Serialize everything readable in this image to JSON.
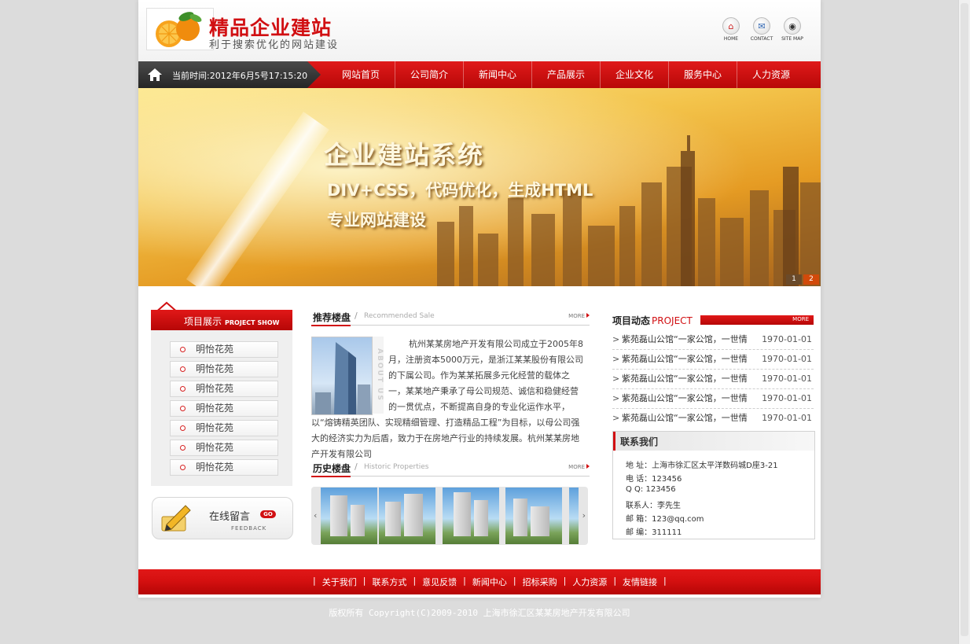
{
  "header": {
    "site_title": "精品企业建站",
    "site_subtitle": "利于搜索优化的网站建设",
    "top_icons": [
      {
        "name": "home-icon",
        "label": "HOME"
      },
      {
        "name": "contact-icon",
        "label": "CONTACT"
      },
      {
        "name": "sitemap-icon",
        "label": "SITE MAP"
      }
    ]
  },
  "nav": {
    "time_text": "当前时间:2012年6月5号17:15:20",
    "links": [
      "网站首页",
      "公司简介",
      "新闻中心",
      "产品展示",
      "企业文化",
      "服务中心",
      "人力资源"
    ]
  },
  "banner": {
    "line1": "企业建站系统",
    "line2": "DIV+CSS，代码优化，生成HTML",
    "line3": "专业网站建设",
    "pager": [
      "1",
      "2"
    ]
  },
  "left": {
    "title": "项目展示",
    "title_en": "PROJECT SHOW",
    "items": [
      "明怡花苑",
      "明怡花苑",
      "明怡花苑",
      "明怡花苑",
      "明怡花苑",
      "明怡花苑",
      "明怡花苑"
    ],
    "feedback_label": "在线留言",
    "feedback_go": "GO",
    "feedback_en": "FEEDBACK"
  },
  "middle": {
    "recommend_title": "推荐楼盘",
    "recommend_en": "Recommended Sale",
    "more": "MORE",
    "about_side": "ABOUT US",
    "about_text": "杭州某某房地产开发有限公司成立于2005年8月，注册资本5000万元，是浙江某某股份有限公司的下属公司。作为某某拓展多元化经营的载体之一，某某地产秉承了母公司规范、诚信和稳健经营的一贯优点，不断提高自身的专业化运作水平，以“熔铸精英团队、实现精细管理、打造精品工程”为目标，以母公司强大的经济实力为后盾，致力于在房地产行业的持续发展。杭州某某房地产开发有限公司",
    "history_title": "历史楼盘",
    "history_en": "Historic Properties",
    "gallery_prev": "‹",
    "gallery_next": "›"
  },
  "right": {
    "title": "项目动态",
    "title_en": "PROJECT",
    "more": "MORE",
    "news": [
      {
        "title": "紫苑磊山公馆“一家公馆，一世情",
        "date": "1970-01-01"
      },
      {
        "title": "紫苑磊山公馆“一家公馆，一世情",
        "date": "1970-01-01"
      },
      {
        "title": "紫苑磊山公馆“一家公馆，一世情",
        "date": "1970-01-01"
      },
      {
        "title": "紫苑磊山公馆“一家公馆，一世情",
        "date": "1970-01-01"
      },
      {
        "title": "紫苑磊山公馆“一家公馆，一世情",
        "date": "1970-01-01"
      }
    ],
    "contact_title": "联系我们",
    "contact_rows": [
      "地 址：上海市徐汇区太平洋数码城D座3-21",
      "电 话：123456",
      "Q Q:  123456",
      "联系人：李先生",
      "邮 箱：123@qq.com",
      "邮 编：311111"
    ]
  },
  "footer": {
    "links": [
      "关于我们",
      "联系方式",
      "意见反馈",
      "新闻中心",
      "招标采购",
      "人力资源",
      "友情链接"
    ],
    "copyright": "版权所有 Copyright(C)2009-2010 上海市徐汇区某某房地产开发有限公司"
  },
  "colors": {
    "brand_red": "#d10f12",
    "nav_dark": "#2f2f2f",
    "banner_gold": "#f3c34a"
  }
}
